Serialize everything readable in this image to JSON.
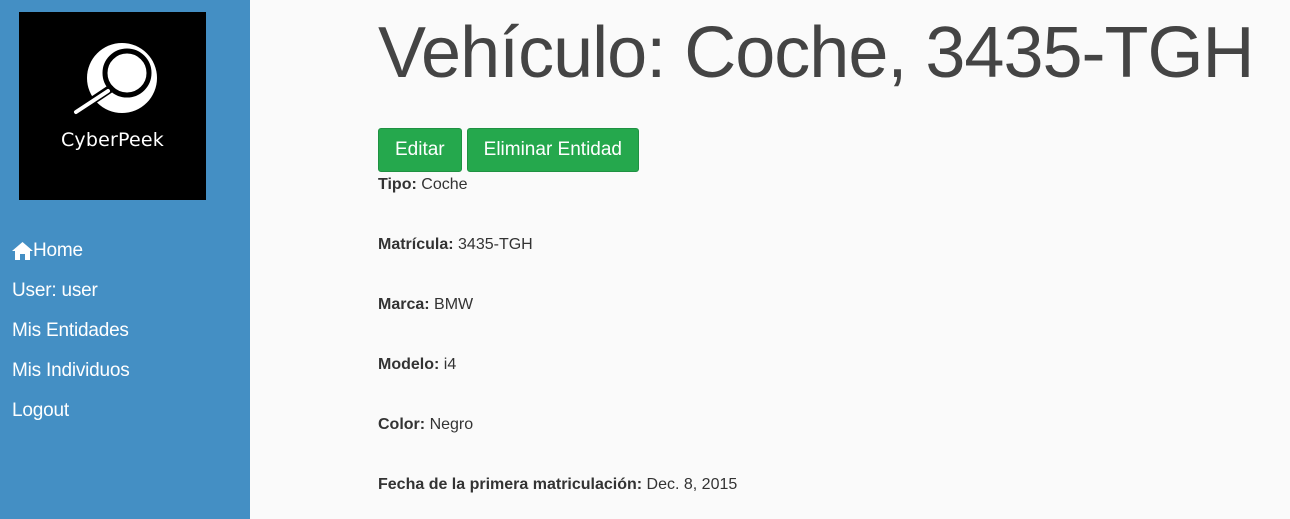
{
  "brand": {
    "logo_text": "CyberPeek"
  },
  "sidebar": {
    "items": [
      {
        "label": "Home",
        "icon": "home-icon"
      },
      {
        "label": "User: user"
      },
      {
        "label": "Mis Entidades"
      },
      {
        "label": "Mis Individuos"
      },
      {
        "label": "Logout"
      }
    ]
  },
  "page": {
    "title": "Vehículo: Coche, 3435-TGH"
  },
  "actions": {
    "edit_label": "Editar",
    "delete_label": "Eliminar Entidad"
  },
  "fields": [
    {
      "label": "Tipo:",
      "value": "Coche"
    },
    {
      "label": "Matrícula:",
      "value": "3435-TGH"
    },
    {
      "label": "Marca:",
      "value": "BMW"
    },
    {
      "label": "Modelo:",
      "value": "i4"
    },
    {
      "label": "Color:",
      "value": "Negro"
    },
    {
      "label": "Fecha de la primera matriculación:",
      "value": "Dec. 8, 2015"
    }
  ],
  "colors": {
    "sidebar_bg": "#448fc4",
    "button_bg": "#25a84d",
    "page_bg": "#fafafa",
    "title_text": "#444444"
  }
}
